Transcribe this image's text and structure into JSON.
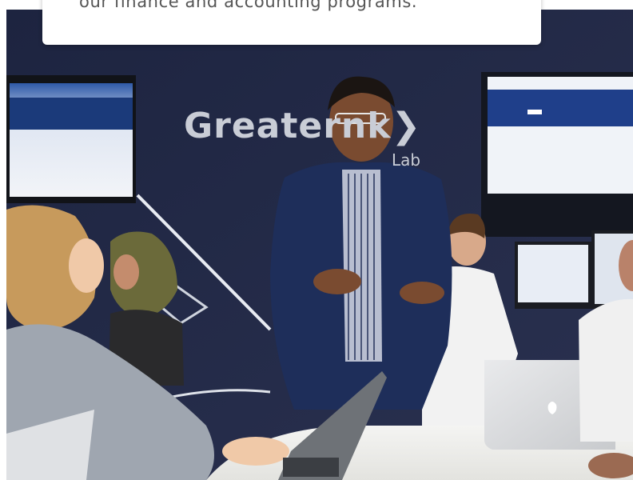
{
  "caption": {
    "text": "our finance and accounting programs."
  },
  "photo": {
    "wall_logo_text": "Greatern",
    "wall_logo_suffix": "k",
    "wall_logo_sub": "Lab"
  },
  "colors": {
    "wall": "#1f2740",
    "card": "#ffffff",
    "caption_text": "#555555",
    "logo": "#c9cdd6"
  }
}
